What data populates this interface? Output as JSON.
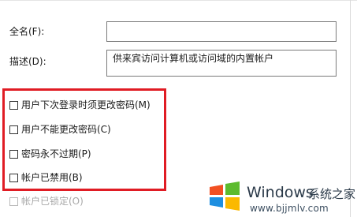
{
  "form": {
    "fullname_label": "全名(F):",
    "fullname_value": "",
    "description_label": "描述(D):",
    "description_value": "供来宾访问计算机或访问域的内置帐户"
  },
  "options": {
    "must_change": {
      "label": "用户下次登录时须更改密码(M)",
      "checked": false
    },
    "cannot_change": {
      "label": "用户不能更改密码(C)",
      "checked": false
    },
    "never_expires": {
      "label": "密码永不过期(P)",
      "checked": false
    },
    "disabled": {
      "label": "帐户已禁用(B)",
      "checked": false
    },
    "locked": {
      "label": "帐户已锁定(O)",
      "checked": false,
      "enabled": false
    }
  },
  "highlight": {
    "color": "#e01c24"
  },
  "watermark": {
    "brand": "Windows",
    "brand_cn": "系统之家",
    "url": "www.bjjmlv.com",
    "logo_icon": "windows-logo-icon",
    "colors": {
      "blue": "#1e8fe0",
      "green": "#5dbb2e",
      "red": "#f25022",
      "yellow": "#fbb900"
    }
  }
}
